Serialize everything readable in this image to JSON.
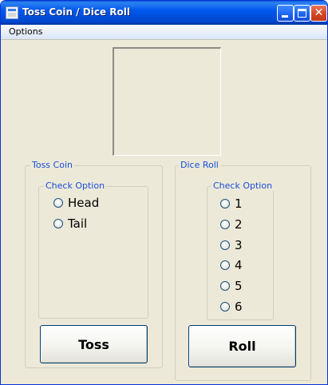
{
  "window": {
    "title": "Toss Coin / Dice Roll",
    "close_glyph": "✕"
  },
  "menu": {
    "items": [
      {
        "label": "Options"
      }
    ]
  },
  "toss_coin": {
    "group_label": "Toss Coin",
    "check_label": "Check Option",
    "options": [
      "Head",
      "Tail"
    ],
    "button_label": "Toss"
  },
  "dice_roll": {
    "group_label": "Dice Roll",
    "check_label": "Check Option",
    "options": [
      "1",
      "2",
      "3",
      "4",
      "5",
      "6"
    ],
    "button_label": "Roll"
  },
  "colors": {
    "titlebar": "#0058ee",
    "window_bg": "#ece9d8",
    "group_label": "#1a4ed8"
  }
}
